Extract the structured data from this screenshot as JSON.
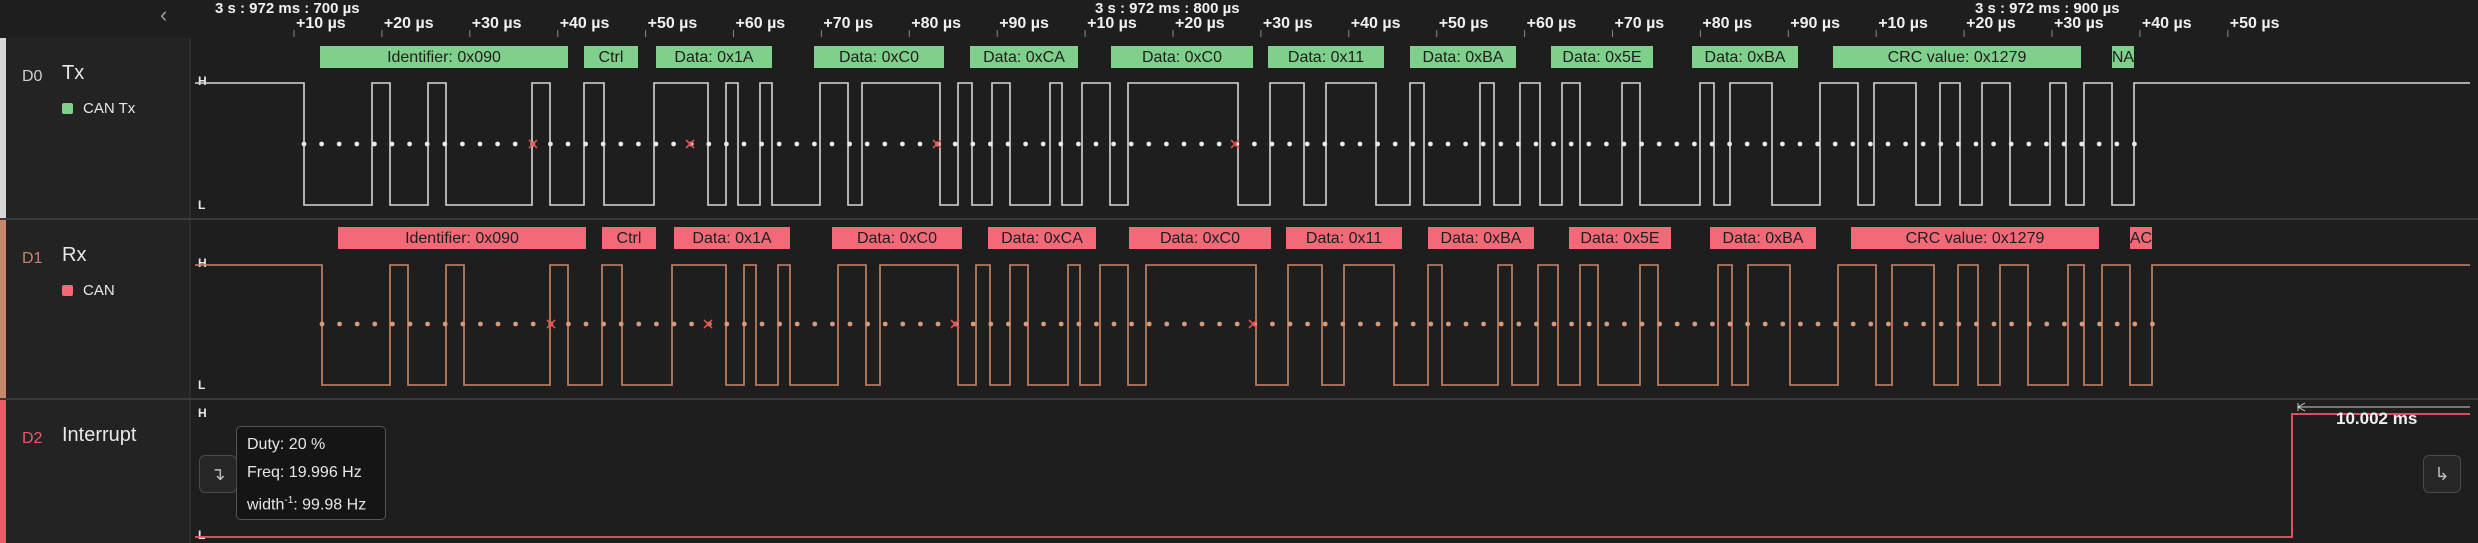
{
  "timebar": {
    "nav_icon": "chevron-left-icon",
    "abs_labels": [
      "3 s : 972 ms : 700 µs",
      "3 s : 972 ms : 800 µs",
      "3 s : 972 ms : 900 µs"
    ],
    "ticks": [
      "+10 µs",
      "+20 µs",
      "+30 µs",
      "+40 µs",
      "+50 µs",
      "+60 µs",
      "+70 µs",
      "+80 µs",
      "+90 µs",
      "+10 µs",
      "+20 µs",
      "+30 µs",
      "+40 µs",
      "+50 µs",
      "+60 µs",
      "+70 µs",
      "+80 µs",
      "+90 µs",
      "+10 µs",
      "+20 µs",
      "+30 µs",
      "+40 µs",
      "+50 µs"
    ]
  },
  "channels": [
    {
      "id": "D0",
      "name": "Tx",
      "color": "#d6d6d6",
      "analyzer": "CAN Tx",
      "analyzer_color": "#7fd08a",
      "hi": "H",
      "lo": "L",
      "frames": [
        "Identifier: 0x090",
        "Ctrl",
        "Data: 0x1A",
        "Data: 0xC0",
        "Data: 0xCA",
        "Data: 0xC0",
        "Data: 0x11",
        "Data: 0xBA",
        "Data: 0x5E",
        "Data: 0xBA",
        "CRC value: 0x1279",
        "NA"
      ]
    },
    {
      "id": "D1",
      "name": "Rx",
      "color": "#c8876a",
      "analyzer": "CAN",
      "analyzer_color": "#f26a78",
      "hi": "H",
      "lo": "L",
      "frames": [
        "Identifier: 0x090",
        "Ctrl",
        "Data: 0x1A",
        "Data: 0xC0",
        "Data: 0xCA",
        "Data: 0xC0",
        "Data: 0x11",
        "Data: 0xBA",
        "Data: 0x5E",
        "Data: 0xBA",
        "CRC value: 0x1279",
        "AC"
      ]
    },
    {
      "id": "D2",
      "name": "Interrupt",
      "color": "#f0586a",
      "hi": "H",
      "lo": "L"
    }
  ],
  "tooltip": {
    "duty": "Duty: 20 %",
    "freq": "Freq: 19.996 Hz",
    "width_prefix": "width",
    "width_sup": "-1",
    "width_value": ": 99.98 Hz"
  },
  "measurement": "10.002 ms",
  "icons": {
    "left_edge": "falling-edge-icon",
    "right_edge": "rising-edge-icon"
  }
}
